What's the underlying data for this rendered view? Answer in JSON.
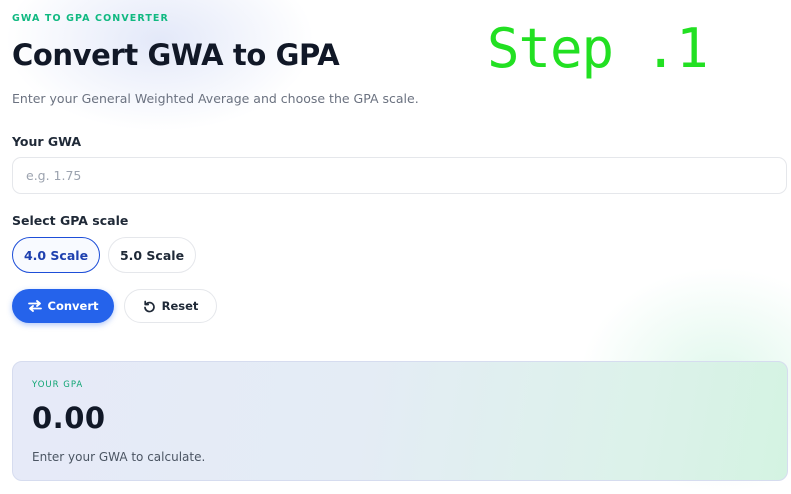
{
  "header": {
    "eyebrow": "GWA TO GPA CONVERTER",
    "title": "Convert GWA to GPA",
    "subtitle": "Enter your General Weighted Average and choose the GPA scale."
  },
  "overlay": {
    "step_text": "Step .1",
    "color": "#22e022"
  },
  "form": {
    "gwa_label": "Your GWA",
    "gwa_value": "",
    "gwa_placeholder": "e.g. 1.75",
    "scale_label": "Select GPA scale",
    "scales": [
      {
        "label": "4.0 Scale",
        "selected": true
      },
      {
        "label": "5.0 Scale",
        "selected": false
      }
    ],
    "convert_label": "Convert",
    "convert_icon": "swap-arrows-icon",
    "reset_label": "Reset",
    "reset_icon": "reset-icon"
  },
  "result": {
    "eyebrow": "YOUR GPA",
    "value": "0.00",
    "hint": "Enter your GWA to calculate."
  },
  "colors": {
    "accent_blue": "#2563eb",
    "accent_green": "#10b981"
  }
}
